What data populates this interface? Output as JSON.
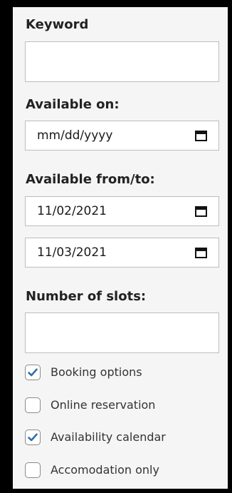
{
  "keyword": {
    "label": "Keyword",
    "value": ""
  },
  "available_on": {
    "label": "Available on:",
    "value": "mm/dd/yyyy"
  },
  "available_range": {
    "label": "Available from/to:",
    "from": "11/02/2021",
    "to": "11/03/2021"
  },
  "slots": {
    "label": "Number of slots:",
    "value": ""
  },
  "options": [
    {
      "label": "Booking options",
      "checked": true
    },
    {
      "label": "Online reservation",
      "checked": false
    },
    {
      "label": "Availability calendar",
      "checked": true
    },
    {
      "label": "Accomodation only",
      "checked": false
    }
  ],
  "colors": {
    "check_accent": "#2f6fb3",
    "panel_bg": "#f5f5f5",
    "outer_bg": "#000000"
  },
  "icons": {
    "date": "calendar-icon",
    "checked": "checkmark-icon"
  }
}
